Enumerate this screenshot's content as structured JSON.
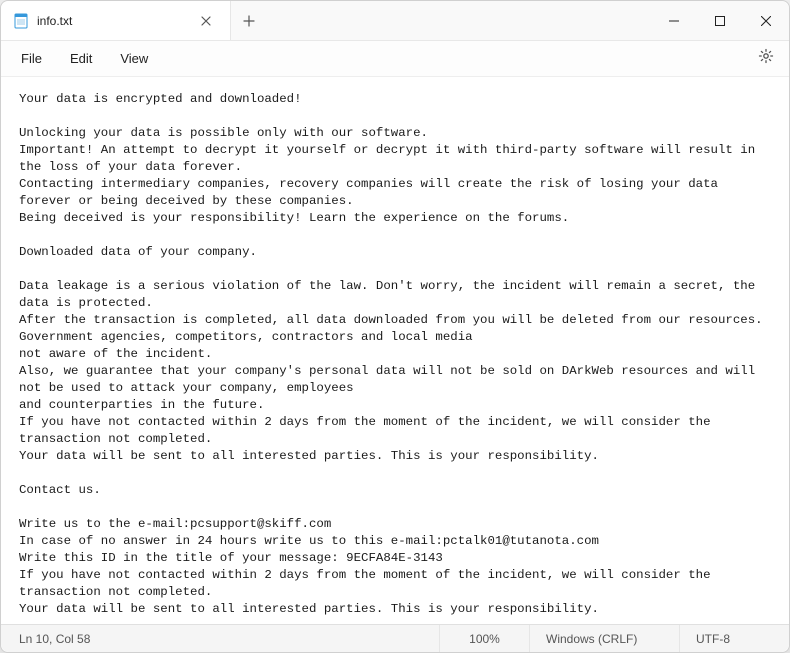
{
  "titlebar": {
    "tab_title": "info.txt",
    "tab_icon": "notepad-icon",
    "close_glyph": "✕",
    "new_tab_glyph": "+"
  },
  "menus": {
    "file": "File",
    "edit": "Edit",
    "view": "View"
  },
  "editor": {
    "content": "Your data is encrypted and downloaded!\n\nUnlocking your data is possible only with our software.\nImportant! An attempt to decrypt it yourself or decrypt it with third-party software will result in the loss of your data forever.\nContacting intermediary companies, recovery companies will create the risk of losing your data forever or being deceived by these companies.\nBeing deceived is your responsibility! Learn the experience on the forums.\n\nDownloaded data of your company.\n\nData leakage is a serious violation of the law. Don't worry, the incident will remain a secret, the data is protected.\nAfter the transaction is completed, all data downloaded from you will be deleted from our resources. Government agencies, competitors, contractors and local media\nnot aware of the incident.\nAlso, we guarantee that your company's personal data will not be sold on DArkWeb resources and will not be used to attack your company, employees\nand counterparties in the future.\nIf you have not contacted within 2 days from the moment of the incident, we will consider the transaction not completed.\nYour data will be sent to all interested parties. This is your responsibility.\n\nContact us.\n\nWrite us to the e-mail:pcsupport@skiff.com\nIn case of no answer in 24 hours write us to this e-mail:pctalk01@tutanota.com\nWrite this ID in the title of your message: 9ECFA84E-3143\nIf you have not contacted within 2 days from the moment of the incident, we will consider the transaction not completed.\nYour data will be sent to all interested parties. This is your responsibility."
  },
  "statusbar": {
    "position": "Ln 10, Col 58",
    "zoom": "100%",
    "eol": "Windows (CRLF)",
    "encoding": "UTF-8"
  }
}
